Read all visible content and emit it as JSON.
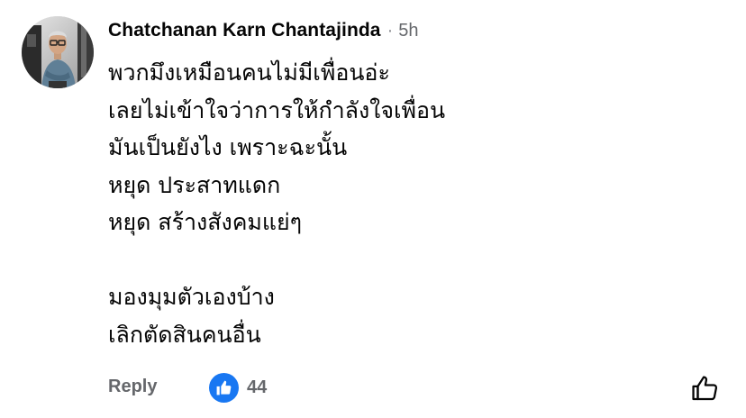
{
  "comment": {
    "author": "Chatchanan Karn Chantajinda",
    "separator": "·",
    "time": "5h",
    "avatar_icon": "profile-photo",
    "lines": [
      "พวกมึงเหมือนคนไม่มีเพื่อนอ่ะ",
      "เลยไม่เข้าใจว่าการให้กำลังใจเพื่อน",
      "มันเป็นยังไง เพราะฉะนั้น",
      "หยุด ประสาทแดก",
      "หยุด สร้างสังคมแย่ๆ",
      "",
      "มองมุมตัวเองบ้าง",
      "เลิกตัดสินคนอื่น"
    ]
  },
  "footer": {
    "reply_label": "Reply",
    "reaction_icon": "thumbs-up-icon",
    "reaction_count": "44",
    "like_icon": "like-outline-icon"
  },
  "colors": {
    "text_primary": "#050505",
    "text_secondary": "#65676b",
    "like_blue": "#1877f2"
  }
}
